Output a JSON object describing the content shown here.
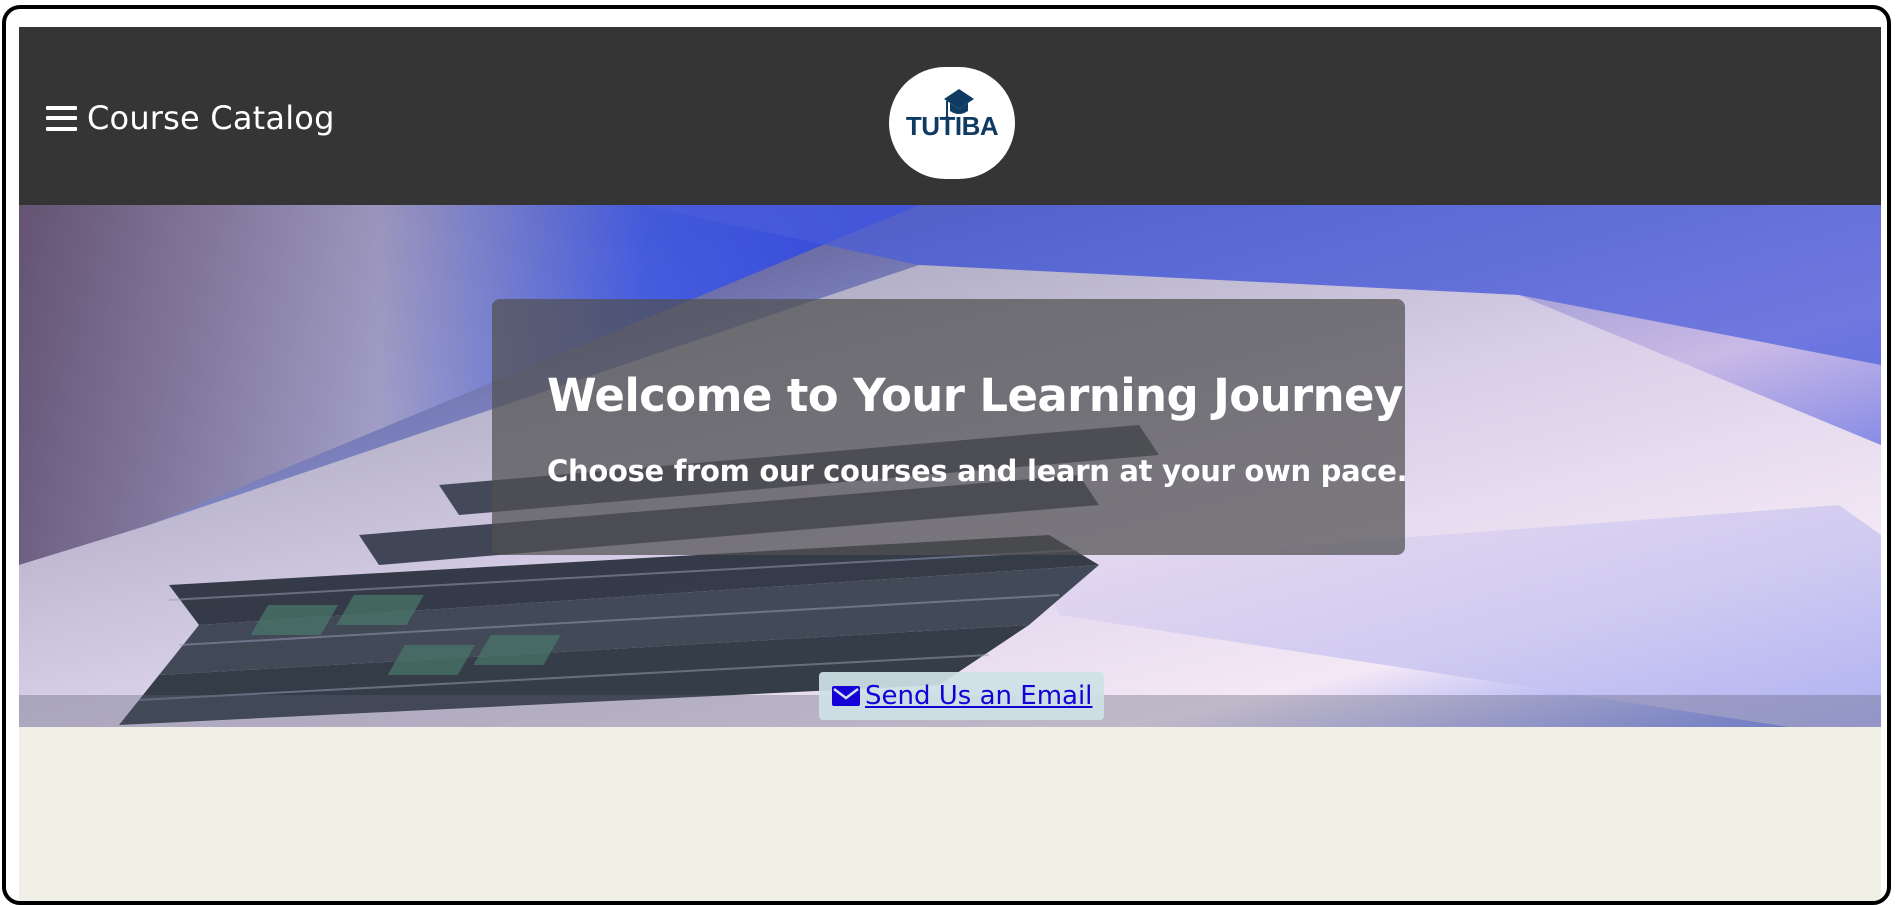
{
  "header": {
    "nav_label": "Course Catalog",
    "logo_text": "TUTIBA"
  },
  "hero": {
    "title": "Welcome to Your Learning Journey",
    "subtitle": "Choose from our courses and learn at your own pace.",
    "email_button_label": "Send Us an Email"
  },
  "icons": {
    "menu": "hamburger-icon",
    "email": "envelope-icon",
    "logo": "graduation-cap-icon"
  },
  "colors": {
    "header_bg": "#353535",
    "page_bg": "#f1f0e6",
    "logo_text": "#0f3b63",
    "link": "#1500d8"
  }
}
